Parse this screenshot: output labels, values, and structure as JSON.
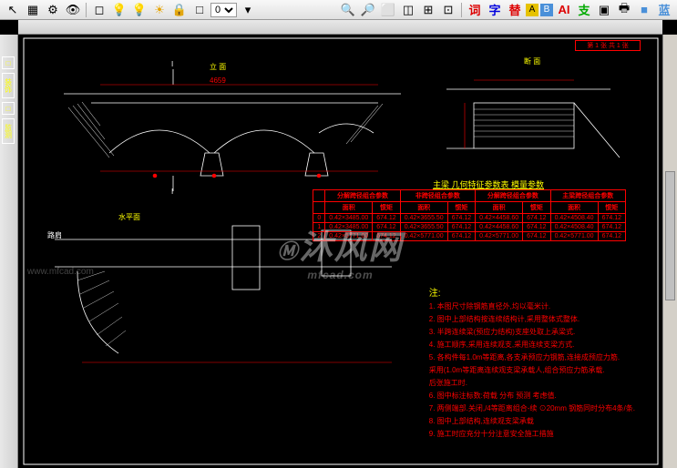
{
  "toolbar": {
    "select_value": "0",
    "icons": [
      "arrow",
      "layers",
      "gear",
      "eye",
      "blank",
      "bulb-yellow",
      "bulb-off",
      "sun",
      "lock",
      "square",
      "chevron",
      "zoom1",
      "zoom2",
      "zoom3",
      "zoom4",
      "zoom5",
      "zoom6",
      "text-ci",
      "text-zi",
      "text-ti",
      "color-a",
      "color-b",
      "ai",
      "text-zi2",
      "sel",
      "print",
      "square-blue",
      "lan"
    ]
  },
  "sidebar": {
    "items": [
      "□",
      "装饰",
      "□",
      "监测"
    ]
  },
  "drawing": {
    "elevation_label": "立 面",
    "section_label": "断 面",
    "plan_label": "水平面",
    "span_dim": "4659",
    "axis_label": "路肩",
    "section_marks": [
      "I",
      "I"
    ],
    "corner_text": "第 1 张 共 1 张"
  },
  "table": {
    "title": "主梁 几何特征参数表 模量参数",
    "headers": [
      "",
      "分解跨径组合参数",
      "",
      "非跨径组合参数",
      "",
      "分解跨径组合参数",
      "",
      "主梁跨径组合参数",
      ""
    ],
    "subheaders": [
      "",
      "面积",
      "惯矩",
      "面积",
      "惯矩",
      "面积",
      "惯矩",
      "面积",
      "惯矩"
    ],
    "rows": [
      {
        "idx": "0",
        "cells": [
          "0.42×3485.00",
          "674.12",
          "0.42×3655.50",
          "674.12",
          "0.42×4458.60",
          "674.12",
          "0.42×4508.40",
          "674.12"
        ]
      },
      {
        "idx": "1",
        "cells": [
          "0.42×3485.00",
          "674.12",
          "0.42×3655.50",
          "674.12",
          "0.42×4458.60",
          "674.12",
          "0.42×4508.40",
          "674.12"
        ]
      },
      {
        "idx": "2",
        "cells": [
          "0.42×5771.00",
          "674.12",
          "0.42×5771.00",
          "674.12",
          "0.42×5771.00",
          "674.12",
          "0.42×5771.00",
          "674.12"
        ]
      }
    ]
  },
  "notes": {
    "title": "注:",
    "items": [
      "1. 本图尺寸除钢筋直径外,均以毫米计.",
      "2. 图中上部结构按连续结构计,采用整体式整体.",
      "3. 半跨连续梁(预应力结构)支座处取上承梁式.",
      "4. 施工顺序,采用连续观支,采用连续支梁方式.",
      "5. 各构件每1.0m等距离,各支承预应力钢筋,连接成预应力筋.",
      "   采用(1.0m等距离连续观支梁承载人,组合预应力筋承载.",
      "   后张施工时.",
      "6. 图中标注标数:荷载 分布 预测 考虑值.",
      "7. 两侧端部.关闭,/4等距离组合-续    ⊙20mm 钢筋同时分布4条/条.",
      "8. 图中上部结构,连续观支梁承载",
      "9. 施工时应充分十分注意安全施工措施"
    ]
  },
  "watermark": {
    "main": "沐风网",
    "sub": "mfcad.com",
    "url": "www.mfcad.com"
  }
}
